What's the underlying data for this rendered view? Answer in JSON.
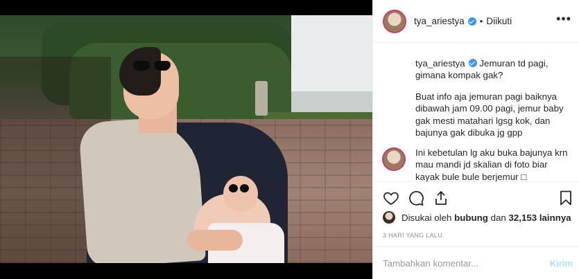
{
  "post": {
    "username": "tya_ariestya",
    "separator": "•",
    "following_label": "Diikuti",
    "more_label": "•••"
  },
  "caption": {
    "username": "tya_ariestya",
    "line1": "Jemuran td pagi,",
    "line2": "gimana kompak gak?",
    "p2_line1": "Buat info aja jemuran pagi baiknya",
    "p2_line2": "dibawah jam 09.00 pagi, jemur baby",
    "p2_line3": "gak mesti matahari lgsg kok, dan",
    "p2_line4": "bajunya gak dibuka jg gpp",
    "p3_line1": "Ini kebetulan lg aku buka bajunya krn",
    "p3_line2": "mau mandi jd skalian di foto biar",
    "p3_line3": "kayak bule bule berjemur □"
  },
  "actions": {
    "like_icon": "heart-icon",
    "comment_icon": "comment-icon",
    "share_icon": "share-icon",
    "save_icon": "bookmark-icon"
  },
  "likes": {
    "prefix": "Disukai oleh",
    "user": "bubung",
    "middle": "dan",
    "count": "32,153 lainnya"
  },
  "timestamp": "3 HARI YANG LALU",
  "comment_input": {
    "placeholder": "Tambahkan komentar...",
    "post_label": "Kirim"
  },
  "colors": {
    "verified": "#3897f0",
    "post_button": "#b2dffc",
    "text": "#262626",
    "muted": "#8e8e8e"
  }
}
